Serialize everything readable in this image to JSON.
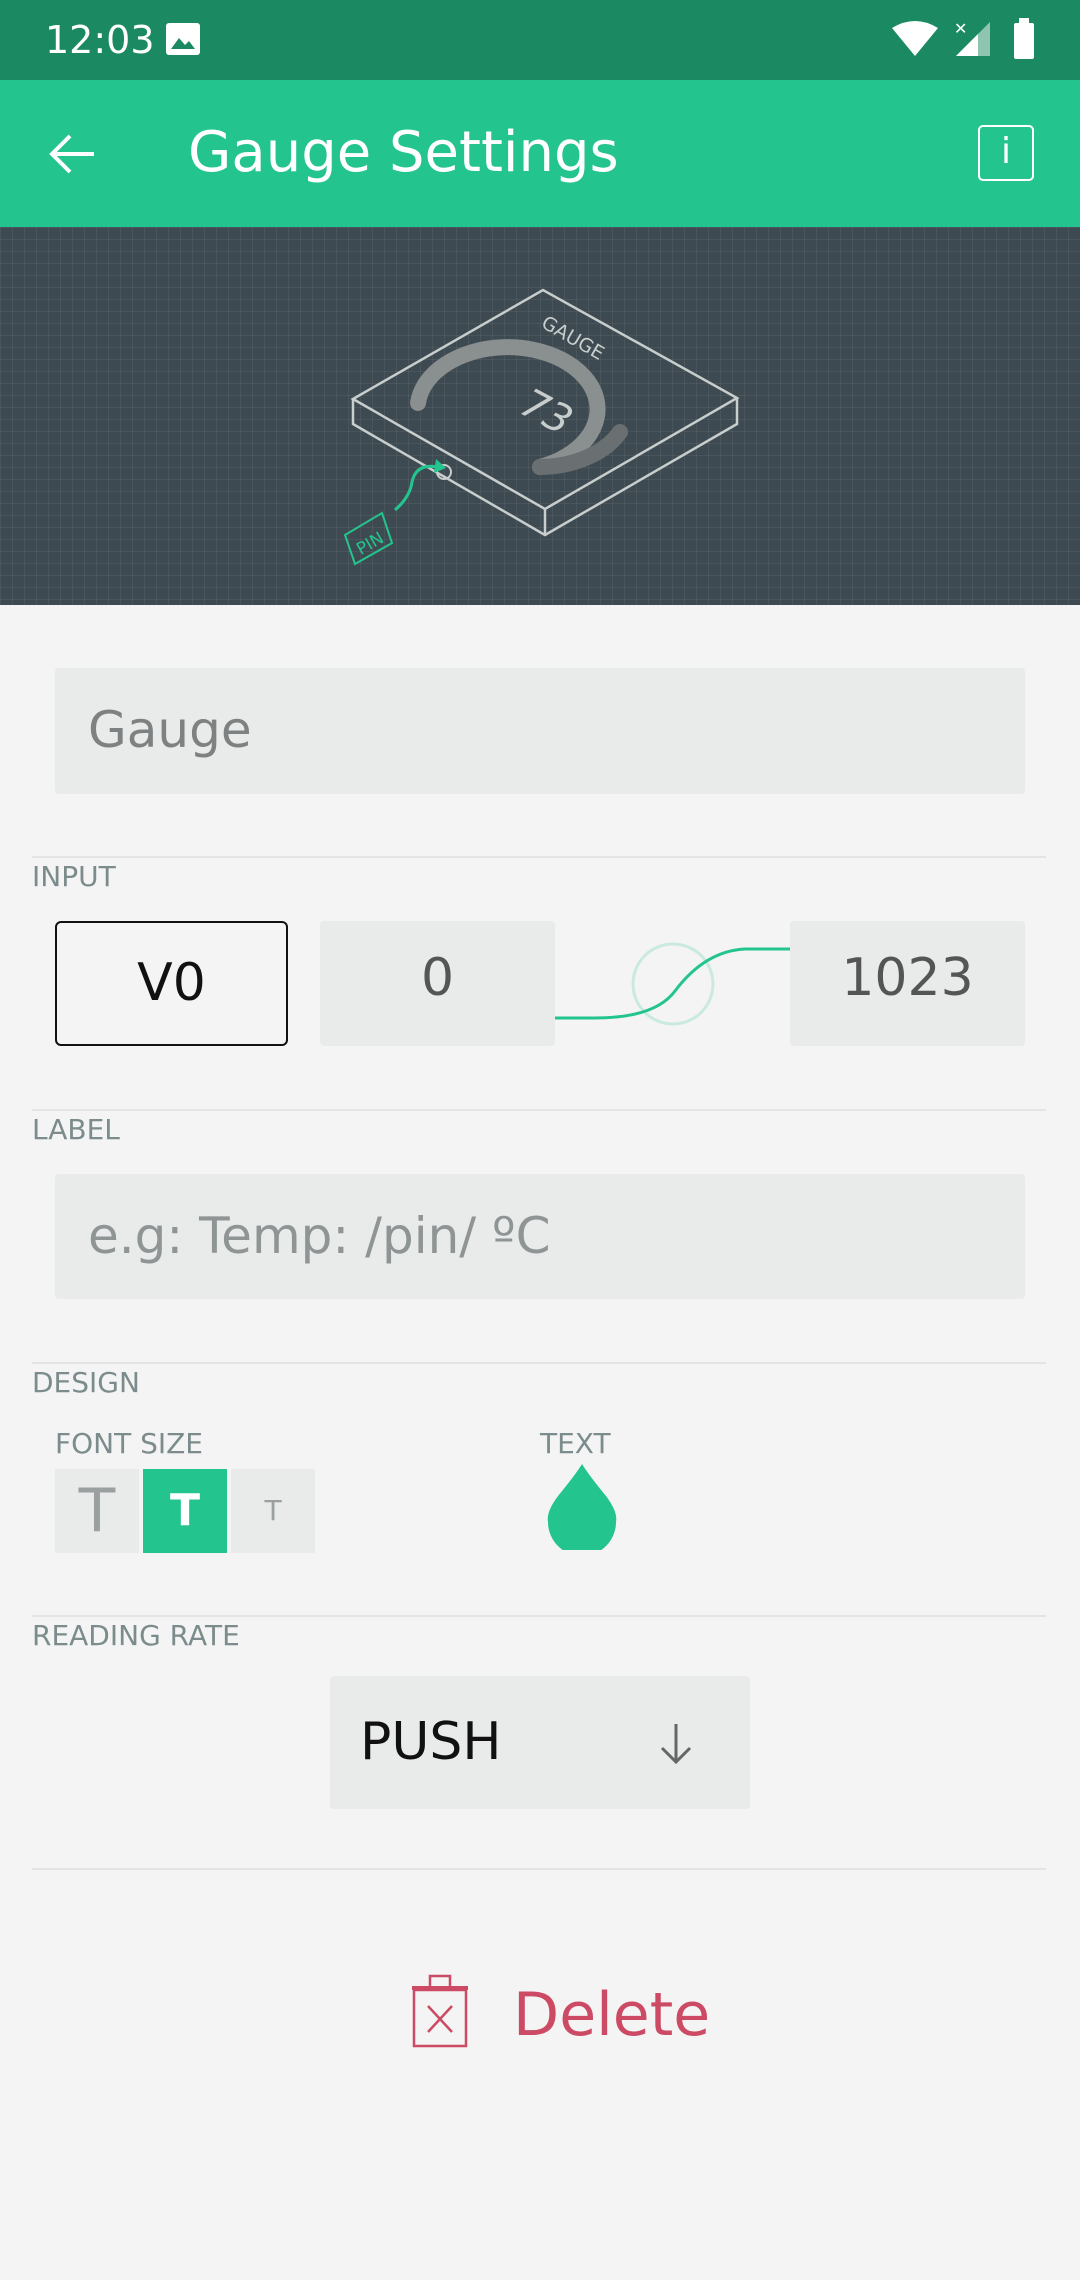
{
  "status_bar": {
    "time": "12:03",
    "icons": [
      "image-icon",
      "wifi-icon",
      "signal-icon",
      "battery-icon"
    ]
  },
  "app_bar": {
    "title": "Gauge Settings",
    "back_icon": "arrow-left-icon",
    "info_icon": "info-icon",
    "info_glyph": "i"
  },
  "hero": {
    "gauge_label": "GAUGE",
    "gauge_value": "73",
    "pin_label": "PIN"
  },
  "name_field": {
    "value": "Gauge"
  },
  "input_section": {
    "title": "INPUT",
    "pin": "V0",
    "min": "0",
    "max": "1023"
  },
  "label_section": {
    "title": "LABEL",
    "placeholder": "e.g: Temp: /pin/ ºC"
  },
  "design_section": {
    "title": "DESIGN",
    "font_size_label": "FONT SIZE",
    "font_options": [
      "T",
      "T",
      "T"
    ],
    "selected_font_index": 1,
    "text_color_label": "TEXT",
    "text_color": "#23c48e"
  },
  "reading_rate": {
    "title": "READING RATE",
    "value": "PUSH"
  },
  "delete": {
    "label": "Delete"
  },
  "colors": {
    "status_bar": "#1b8a63",
    "app_bar": "#23c48e",
    "accent": "#23c48e",
    "danger": "#cc4a64",
    "hero_bg": "#3e4a51"
  }
}
